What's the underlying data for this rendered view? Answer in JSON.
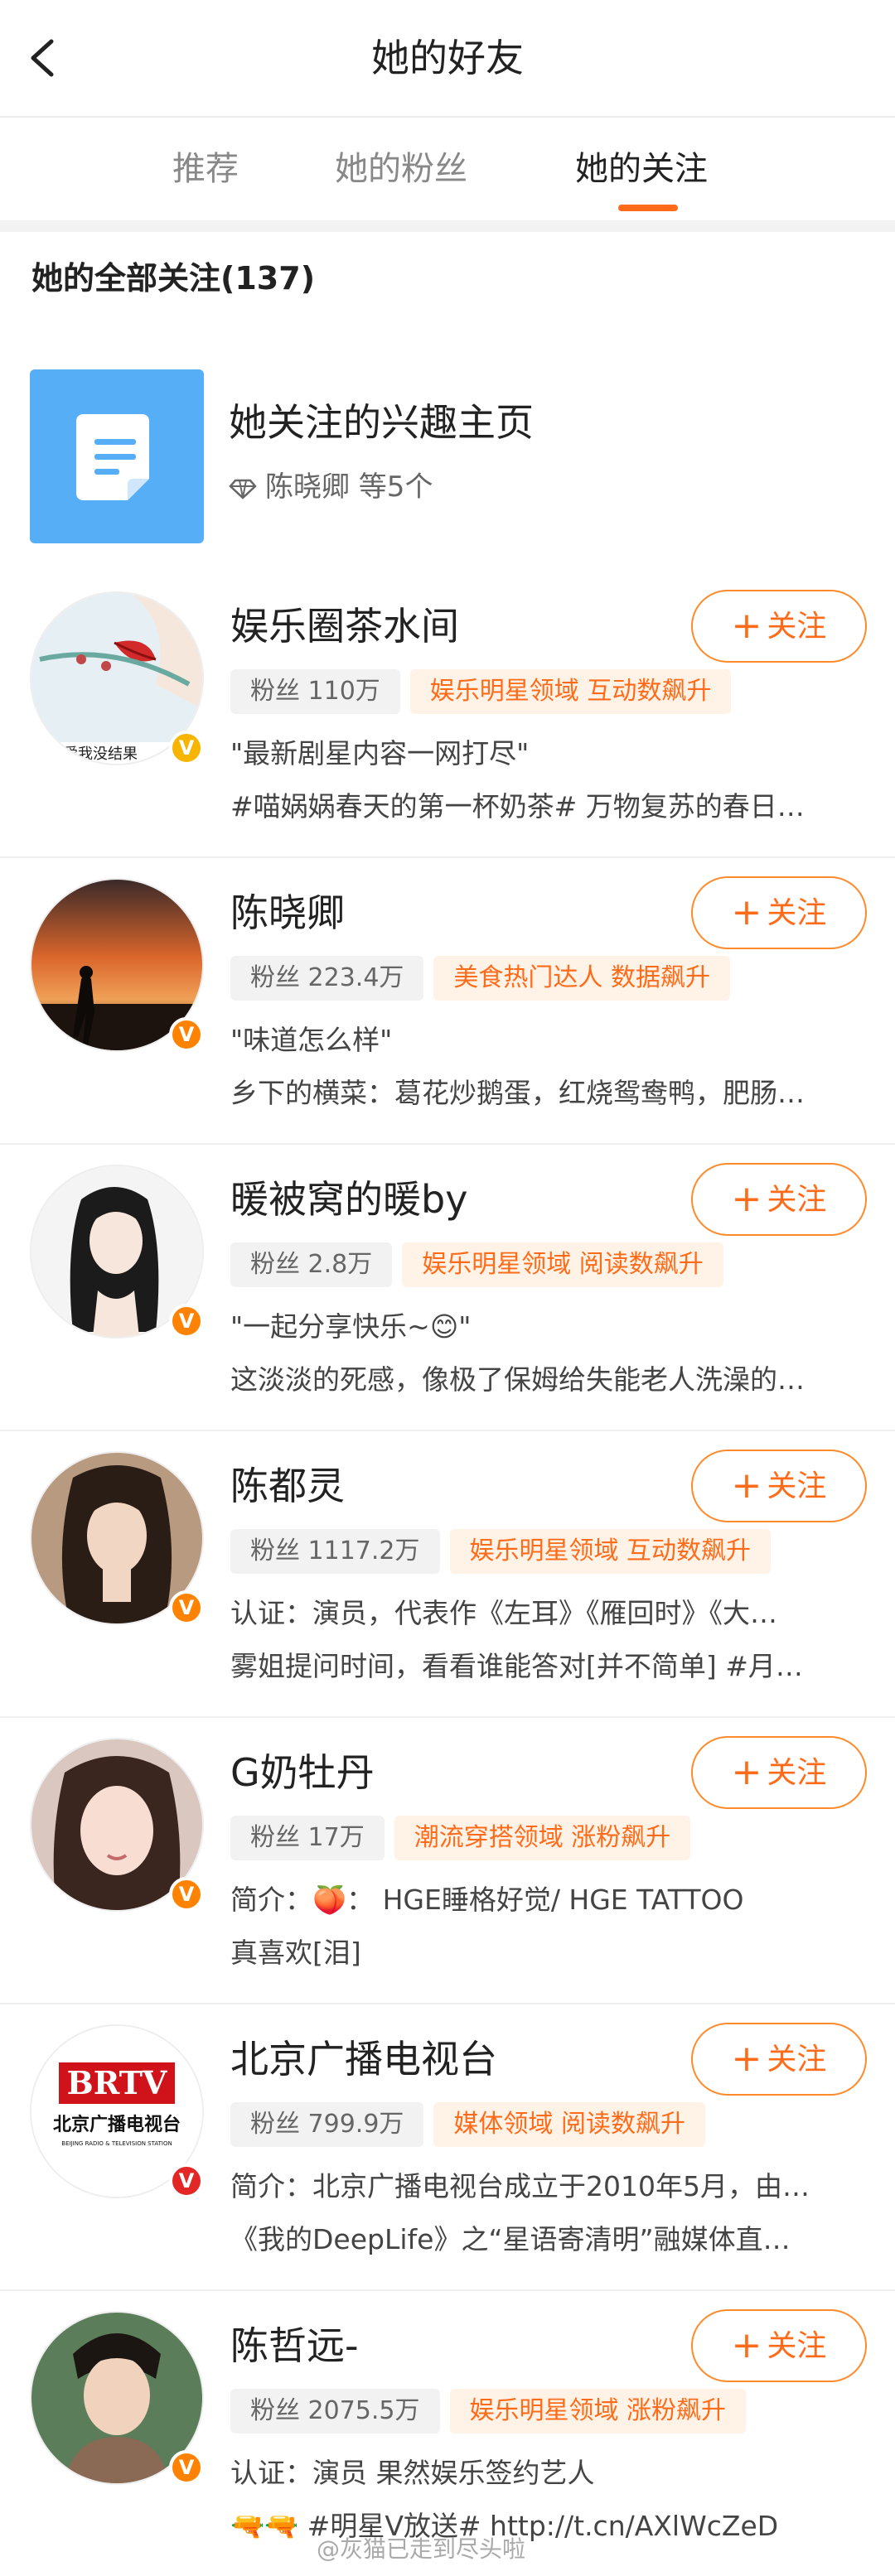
{
  "header": {
    "title": "她的好友"
  },
  "tabs": [
    {
      "label": "推荐"
    },
    {
      "label": "她的粉丝"
    },
    {
      "label": "她的关注"
    }
  ],
  "section": {
    "title": "她的全部关注(137)"
  },
  "interest": {
    "title": "她关注的兴趣主页",
    "subtitle": "陈晓卿 等5个"
  },
  "follow_label": "关注",
  "users": [
    {
      "name": "娱乐圈茶水间",
      "fans": "粉丝 110万",
      "domain": "娱乐明星领域 互动数飙升",
      "line1": "\"最新剧星内容一网打尽\"",
      "line2": "#喵娲娲春天的第一杯奶茶# 万物复苏的春日…",
      "badge": "gold"
    },
    {
      "name": "陈晓卿",
      "fans": "粉丝 223.4万",
      "domain": "美食热门达人 数据飙升",
      "line1": "\"味道怎么样\"",
      "line2": "乡下的横菜：葛花炒鹅蛋，红烧鸳鸯鸭，肥肠…",
      "badge": "orange"
    },
    {
      "name": "暖被窝的暖by",
      "fans": "粉丝 2.8万",
      "domain": "娱乐明星领域 阅读数飙升",
      "line1": "\"一起分享快乐~😊\"",
      "line2": "这淡淡的死感，像极了保姆给失能老人洗澡的…",
      "badge": "orange"
    },
    {
      "name": "陈都灵",
      "fans": "粉丝 1117.2万",
      "domain": "娱乐明星领域 互动数飙升",
      "line1": "认证：演员，代表作《左耳》《雁回时》《大…",
      "line2": "雾姐提问时间，看看谁能答对[并不简单] #月…",
      "badge": "orange"
    },
    {
      "name": "G奶牡丹",
      "fans": "粉丝 17万",
      "domain": "潮流穿搭领域 涨粉飙升",
      "line1": "简介：🍑： HGE睡格好觉/ HGE TATTOO",
      "line2": "真喜欢[泪]",
      "badge": "orange"
    },
    {
      "name": "北京广播电视台",
      "fans": "粉丝 799.9万",
      "domain": "媒体领域 阅读数飙升",
      "line1": "简介：北京广播电视台成立于2010年5月，由…",
      "line2": "《我的DeepLife》之“星语寄清明”融媒体直…",
      "badge": "red"
    },
    {
      "name": "陈哲远-",
      "fans": "粉丝 2075.5万",
      "domain": "娱乐明星领域 涨粉飙升",
      "line1": "认证：演员 果然娱乐签约艺人",
      "line2": "🔫🔫 #明星V放送# http://t.cn/AXlWcZeD",
      "badge": "orange"
    }
  ],
  "logo": {
    "brtv_text": "BRTV",
    "brtv_cn": "北京广播电视台",
    "brtv_en": "BEIJING RADIO & TELEVISION STATION"
  },
  "watermark": "@灰猫已走到尽头啦",
  "colors": {
    "accent": "#ff6b18",
    "interest_icon": "#55aef6",
    "v_gold": "#f7b500",
    "v_orange": "#ff8200",
    "v_red": "#e32626"
  }
}
